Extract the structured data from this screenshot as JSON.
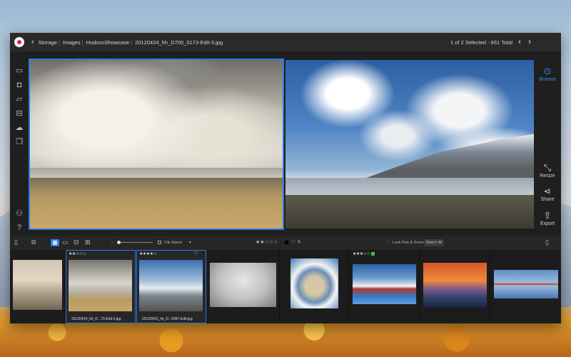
{
  "breadcrumb": {
    "items": [
      "Storage",
      "Images",
      "HudsonShowcase",
      "20120424_hh_D700_0173-Edit-3.jpg"
    ]
  },
  "selection_info": "1 of 2 Selected - 661 Total",
  "right_rail": {
    "browse": "Browse",
    "resize": "Resize",
    "share": "Share",
    "export": "Export"
  },
  "toolbar": {
    "sort_label": "File Name",
    "rating": "★★☆☆☆",
    "lock_pan_zoom": "Lock Pan & Zoom",
    "match_all": "Match All"
  },
  "filmstrip": [
    {
      "rating": "",
      "caption": ""
    },
    {
      "rating": "★★☆☆☆",
      "caption": "20120424_hh_D...73-Edit-3.jpg"
    },
    {
      "rating": "★★★★☆",
      "caption": "20120425_hh_D...0087-Edit.jpg"
    },
    {
      "rating": "",
      "caption": ""
    },
    {
      "rating": "",
      "caption": ""
    },
    {
      "rating": "★★★☆☆",
      "caption": ""
    },
    {
      "rating": "",
      "caption": ""
    },
    {
      "rating": "",
      "caption": ""
    }
  ],
  "colors": {
    "accent": "#2a7be6",
    "window_bg": "#1f1f1f",
    "label_green": "#36c24a",
    "label_black": "#000000"
  }
}
